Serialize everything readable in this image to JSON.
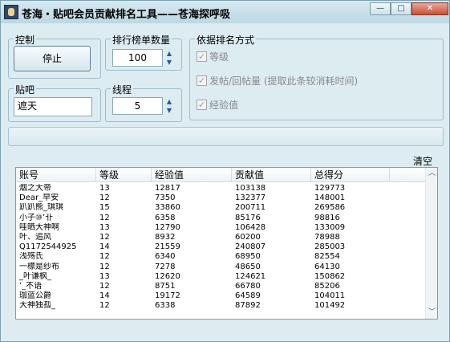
{
  "window": {
    "title": "苍海・贴吧会员贡献排名工具——苍海探呼吸",
    "buttons": {
      "minimize": "—",
      "maximize": "□",
      "close": "✕"
    }
  },
  "control": {
    "group_label": "控制",
    "stop_button": "停止"
  },
  "rank_count": {
    "group_label": "排行榜单数量",
    "value": "100"
  },
  "criteria": {
    "group_label": "依据排名方式",
    "options": [
      {
        "label": "等级",
        "checked": true
      },
      {
        "label": "发帖/回帖量 (提取此条较消耗时间)",
        "checked": true
      },
      {
        "label": "经验值",
        "checked": true
      }
    ]
  },
  "forum": {
    "group_label": "贴吧",
    "value": "遮天"
  },
  "threads": {
    "group_label": "线程",
    "value": "5"
  },
  "progress": {
    "value": 0
  },
  "clear_label": "清空",
  "table": {
    "columns": [
      "账号",
      "等级",
      "经验值",
      "贡献值",
      "总得分"
    ],
    "rows": [
      [
        "烟之大帝",
        "13",
        "12817",
        "103138",
        "129773"
      ],
      [
        "Dear_早安",
        "12",
        "7350",
        "132377",
        "148001"
      ],
      [
        "趴趴熊_琪琪",
        "15",
        "33860",
        "200711",
        "269586"
      ],
      [
        "小子⑩ʼ卝",
        "12",
        "6358",
        "85176",
        "98816"
      ],
      [
        "哇晒大神啊",
        "13",
        "12790",
        "106428",
        "133009"
      ],
      [
        "叶、追风",
        "12",
        "8932",
        "60200",
        "78988"
      ],
      [
        "Q1172544925",
        "14",
        "21559",
        "240807",
        "285003"
      ],
      [
        "浅殇氏",
        "12",
        "6340",
        "68950",
        "82554"
      ],
      [
        "一檬是纱布",
        "12",
        "7278",
        "48650",
        "64130"
      ],
      [
        "_叶谦枫_",
        "13",
        "12620",
        "124621",
        "150862"
      ],
      [
        "ʼ_不语",
        "12",
        "8751",
        "66780",
        "85206"
      ],
      [
        "珈蓝公爵",
        "14",
        "19172",
        "64589",
        "104011"
      ],
      [
        "大神独孤_",
        "12",
        "6338",
        "87892",
        "101492"
      ]
    ]
  },
  "icons": {
    "spin_up": "chevron-up-icon",
    "spin_down": "chevron-down-icon",
    "check": "checkmark-icon"
  }
}
